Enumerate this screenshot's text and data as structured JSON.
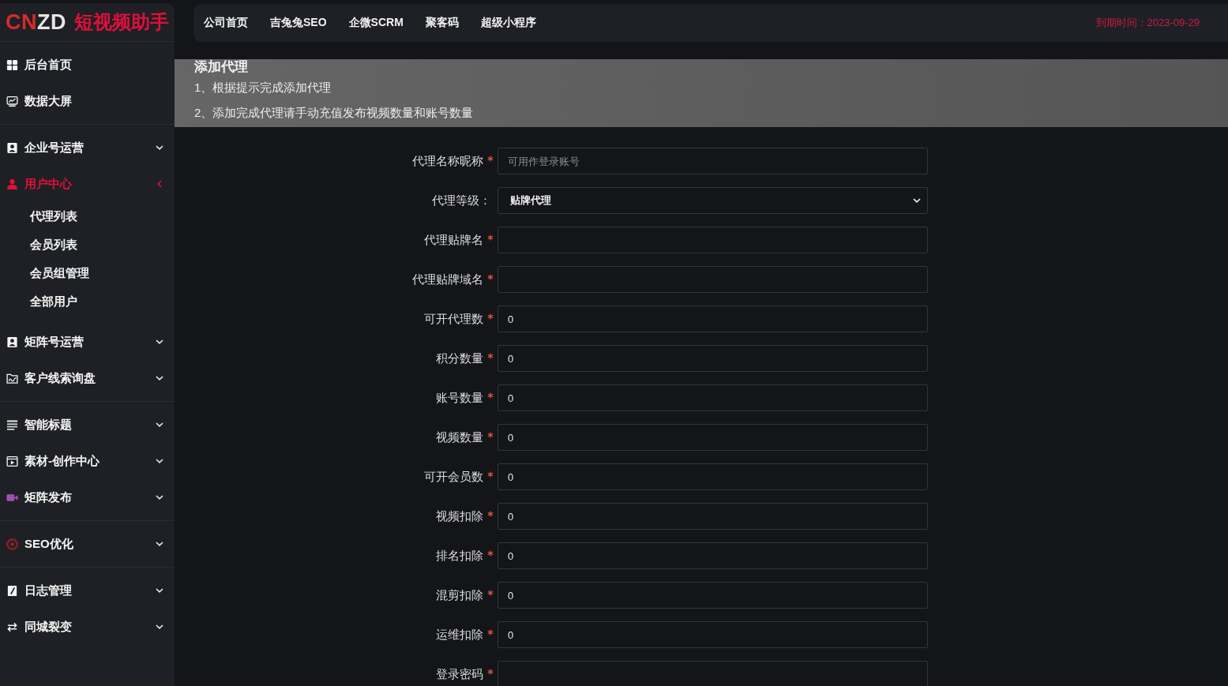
{
  "sidebar": {
    "logo": {
      "mark_parts": [
        "CN",
        "ZD"
      ],
      "title": "短视频助手"
    },
    "groups": [
      {
        "items": [
          {
            "label": "后台首页",
            "selected": false
          },
          {
            "label": "数据大屏",
            "selected": false
          }
        ]
      },
      {
        "items": [
          {
            "label": "企业号运营",
            "selected": false,
            "expanded": false
          },
          {
            "label": "用户中心",
            "selected": true,
            "expanded": true,
            "children": [
              {
                "label": "代理列表",
                "selected": false
              },
              {
                "label": "会员列表",
                "selected": false
              },
              {
                "label": "会员组管理",
                "selected": false
              },
              {
                "label": "全部用户",
                "selected": false
              }
            ]
          },
          {
            "label": "矩阵号运营",
            "selected": false,
            "expanded": false
          },
          {
            "label": "客户线索询盘",
            "selected": false,
            "expanded": false
          }
        ]
      },
      {
        "items": [
          {
            "label": "智能标题",
            "selected": false,
            "expanded": false
          },
          {
            "label": "素材-创作中心",
            "selected": false,
            "expanded": false
          },
          {
            "label": "矩阵发布",
            "selected": false,
            "expanded": false
          }
        ]
      },
      {
        "items": [
          {
            "label": "SEO优化",
            "selected": false,
            "expanded": false
          }
        ]
      },
      {
        "items": [
          {
            "label": "日志管理",
            "selected": false,
            "expanded": false
          },
          {
            "label": "同城裂变",
            "selected": false,
            "expanded": false
          }
        ]
      }
    ]
  },
  "top_nav": {
    "links": [
      "公司首页",
      "吉兔兔SEO",
      "企微SCRM",
      "聚客码",
      "超级小程序"
    ],
    "expiry": "到期时间：2023-09-29"
  },
  "notice": {
    "title": "添加代理",
    "lines": [
      "1、根据提示完成添加代理",
      "2、添加完成代理请手动充值发布视频数量和账号数量"
    ]
  },
  "form": {
    "fields": [
      {
        "kind": "text",
        "label": "代理名称昵称",
        "required": true,
        "placeholder": "可用作登录账号"
      },
      {
        "kind": "select",
        "label": "代理等级：",
        "required": false,
        "value": "贴牌代理"
      },
      {
        "kind": "text",
        "label": "代理贴牌名",
        "required": true
      },
      {
        "kind": "text",
        "label": "代理贴牌域名",
        "required": true
      },
      {
        "kind": "text",
        "label": "可开代理数",
        "required": true,
        "value": "0"
      },
      {
        "kind": "text",
        "label": "积分数量",
        "required": true,
        "value": "0"
      },
      {
        "kind": "text",
        "label": "账号数量",
        "required": true,
        "value": "0"
      },
      {
        "kind": "text",
        "label": "视频数量",
        "required": true,
        "value": "0"
      },
      {
        "kind": "text",
        "label": "可开会员数",
        "required": true,
        "value": "0"
      },
      {
        "kind": "text",
        "label": "视频扣除",
        "required": true,
        "value": "0"
      },
      {
        "kind": "text",
        "label": "排名扣除",
        "required": true,
        "value": "0"
      },
      {
        "kind": "text",
        "label": "混剪扣除",
        "required": true,
        "value": "0"
      },
      {
        "kind": "text",
        "label": "运维扣除",
        "required": true,
        "value": "0"
      },
      {
        "kind": "password",
        "label": "登录密码",
        "required": true
      }
    ]
  }
}
